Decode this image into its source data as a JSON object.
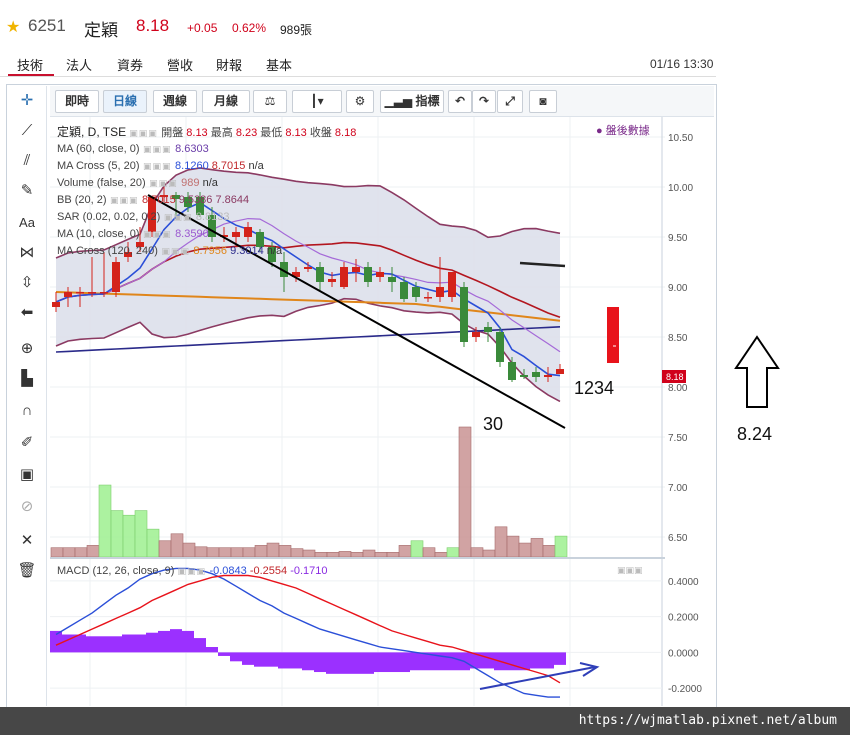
{
  "header": {
    "code": "6251",
    "name": "定穎",
    "price": "8.18",
    "change": "+0.05",
    "change_pct": "0.62%",
    "volume": "989張"
  },
  "tabs": [
    "技術",
    "法人",
    "資券",
    "營收",
    "財報",
    "基本"
  ],
  "datetime": "01/16 13:30",
  "toolbar": {
    "buttons": [
      "即時",
      "日線",
      "週線",
      "月線"
    ],
    "indicator_label": "指標"
  },
  "legend": {
    "title": "定穎, D, TSE",
    "ohlc": {
      "open_label": "開盤",
      "open": "8.13",
      "high_label": "最高",
      "high": "8.23",
      "low_label": "最低",
      "low": "8.13",
      "close_label": "收盤",
      "close": "8.18"
    },
    "after_hours": "盤後數據",
    "lines": [
      {
        "label": "MA (60, close, 0)",
        "values": [
          "8.6303"
        ],
        "colors": [
          "#6a3da8"
        ]
      },
      {
        "label": "MA Cross (5, 20)",
        "values": [
          "8.1260",
          "8.7015",
          "n/a"
        ],
        "colors": [
          "#2b4fd8",
          "#c0262a",
          "#333333"
        ]
      },
      {
        "label": "Volume (false, 20)",
        "values": [
          "989",
          "n/a"
        ],
        "colors": [
          "#c07070",
          "#333333"
        ]
      },
      {
        "label": "BB (20, 2)",
        "values": [
          "8.7015",
          "9.5386",
          "7.8644"
        ],
        "colors": [
          "#c0262a",
          "#8b3a62",
          "#8b3a62"
        ]
      },
      {
        "label": "SAR (0.02, 0.02, 0.2)",
        "values": [
          "8.8133"
        ],
        "colors": [
          "#bbbbbb"
        ]
      },
      {
        "label": "MA (10, close, 0)",
        "values": [
          "8.3590"
        ],
        "colors": [
          "#9b59d0"
        ]
      },
      {
        "label": "MA Cross (120, 240)",
        "values": [
          "8.7956",
          "9.3014",
          "n/a"
        ],
        "colors": [
          "#e0861a",
          "#2a2a8a",
          "#333333"
        ]
      }
    ],
    "macd_label": "MACD (12, 26, close, 9)",
    "macd_values": [
      "-0.0843",
      "-0.2554",
      "-0.1710"
    ],
    "macd_colors": [
      "#2b4fd8",
      "#c0262a",
      "#8a2be2"
    ]
  },
  "price_axis": [
    "10.50",
    "10.00",
    "9.50",
    "9.00",
    "8.50",
    "8.00",
    "7.50",
    "7.00",
    "6.50"
  ],
  "price_tag": "8.18",
  "macd_axis": [
    "0.4000",
    "0.2000",
    "0.0000",
    "-0.2000"
  ],
  "annotations": {
    "label_1234": "1234",
    "label_30": "30",
    "label_824": "8.24"
  },
  "watermark_url": "https://wjmatlab.pixnet.net/album",
  "chart_data": {
    "type": "candlestick",
    "price_range": [
      6.3,
      10.7
    ],
    "candles": [
      {
        "o": 8.8,
        "h": 8.95,
        "l": 8.75,
        "c": 8.85
      },
      {
        "o": 8.9,
        "h": 9.0,
        "l": 8.8,
        "c": 8.95
      },
      {
        "o": 8.95,
        "h": 9.0,
        "l": 8.8,
        "c": 8.95
      },
      {
        "o": 8.95,
        "h": 9.3,
        "l": 8.9,
        "c": 8.95
      },
      {
        "o": 8.95,
        "h": 9.35,
        "l": 8.9,
        "c": 8.95
      },
      {
        "o": 8.95,
        "h": 9.3,
        "l": 8.9,
        "c": 9.25
      },
      {
        "o": 9.3,
        "h": 9.45,
        "l": 9.25,
        "c": 9.35
      },
      {
        "o": 9.4,
        "h": 9.6,
        "l": 9.35,
        "c": 9.45
      },
      {
        "o": 9.55,
        "h": 9.9,
        "l": 9.5,
        "c": 9.9
      },
      {
        "o": 9.9,
        "h": 10.0,
        "l": 9.85,
        "c": 9.92
      },
      {
        "o": 9.92,
        "h": 9.95,
        "l": 9.7,
        "c": 9.88
      },
      {
        "o": 9.9,
        "h": 9.95,
        "l": 9.75,
        "c": 9.8
      },
      {
        "o": 9.9,
        "h": 9.95,
        "l": 9.7,
        "c": 9.72
      },
      {
        "o": 9.72,
        "h": 9.8,
        "l": 9.45,
        "c": 9.5
      },
      {
        "o": 9.5,
        "h": 9.6,
        "l": 9.45,
        "c": 9.52
      },
      {
        "o": 9.5,
        "h": 9.6,
        "l": 9.4,
        "c": 9.55
      },
      {
        "o": 9.5,
        "h": 9.65,
        "l": 9.45,
        "c": 9.6
      },
      {
        "o": 9.55,
        "h": 9.58,
        "l": 9.35,
        "c": 9.4
      },
      {
        "o": 9.4,
        "h": 9.45,
        "l": 9.2,
        "c": 9.25
      },
      {
        "o": 9.25,
        "h": 9.35,
        "l": 8.95,
        "c": 9.1
      },
      {
        "o": 9.1,
        "h": 9.2,
        "l": 9.05,
        "c": 9.15
      },
      {
        "o": 9.18,
        "h": 9.25,
        "l": 9.15,
        "c": 9.2
      },
      {
        "o": 9.2,
        "h": 9.25,
        "l": 8.95,
        "c": 9.05
      },
      {
        "o": 9.05,
        "h": 9.15,
        "l": 9.0,
        "c": 9.08
      },
      {
        "o": 9.0,
        "h": 9.25,
        "l": 8.98,
        "c": 9.2
      },
      {
        "o": 9.15,
        "h": 9.28,
        "l": 9.05,
        "c": 9.2
      },
      {
        "o": 9.2,
        "h": 9.25,
        "l": 9.0,
        "c": 9.05
      },
      {
        "o": 9.1,
        "h": 9.2,
        "l": 9.05,
        "c": 9.15
      },
      {
        "o": 9.1,
        "h": 9.2,
        "l": 8.95,
        "c": 9.05
      },
      {
        "o": 9.05,
        "h": 9.1,
        "l": 8.85,
        "c": 8.88
      },
      {
        "o": 9.0,
        "h": 9.05,
        "l": 8.85,
        "c": 8.9
      },
      {
        "o": 8.9,
        "h": 8.95,
        "l": 8.85,
        "c": 8.9
      },
      {
        "o": 8.9,
        "h": 9.3,
        "l": 8.85,
        "c": 9.0
      },
      {
        "o": 8.9,
        "h": 9.15,
        "l": 8.85,
        "c": 9.15
      },
      {
        "o": 9.0,
        "h": 9.05,
        "l": 8.4,
        "c": 8.45
      },
      {
        "o": 8.5,
        "h": 8.6,
        "l": 8.45,
        "c": 8.55
      },
      {
        "o": 8.6,
        "h": 8.65,
        "l": 8.45,
        "c": 8.55
      },
      {
        "o": 8.55,
        "h": 8.6,
        "l": 8.2,
        "c": 8.25
      },
      {
        "o": 8.25,
        "h": 8.3,
        "l": 8.05,
        "c": 8.07
      },
      {
        "o": 8.12,
        "h": 8.18,
        "l": 8.08,
        "c": 8.1
      },
      {
        "o": 8.15,
        "h": 8.2,
        "l": 8.05,
        "c": 8.1
      },
      {
        "o": 8.1,
        "h": 8.2,
        "l": 8.05,
        "c": 8.12
      },
      {
        "o": 8.13,
        "h": 8.23,
        "l": 8.13,
        "c": 8.18
      }
    ],
    "volume": [
      0.2,
      0.2,
      0.2,
      0.25,
      1.55,
      1.0,
      0.9,
      1.0,
      0.6,
      0.35,
      0.5,
      0.3,
      0.22,
      0.2,
      0.2,
      0.2,
      0.2,
      0.25,
      0.3,
      0.25,
      0.18,
      0.15,
      0.1,
      0.1,
      0.12,
      0.1,
      0.15,
      0.1,
      0.1,
      0.25,
      0.35,
      0.2,
      0.1,
      0.2,
      2.8,
      0.2,
      0.15,
      0.65,
      0.45,
      0.3,
      0.4,
      0.25,
      0.45
    ],
    "volume_up": [
      false,
      false,
      false,
      false,
      true,
      true,
      true,
      true,
      true,
      false,
      false,
      false,
      false,
      false,
      false,
      false,
      false,
      false,
      false,
      false,
      false,
      false,
      false,
      false,
      false,
      false,
      false,
      false,
      false,
      false,
      true,
      false,
      false,
      true,
      false,
      false,
      false,
      false,
      false,
      false,
      false,
      false,
      true
    ],
    "macd_range": [
      -0.3,
      0.5
    ],
    "macd_hist": [
      0.12,
      0.1,
      0.1,
      0.09,
      0.09,
      0.09,
      0.1,
      0.1,
      0.11,
      0.12,
      0.13,
      0.12,
      0.08,
      0.03,
      -0.02,
      -0.05,
      -0.07,
      -0.08,
      -0.08,
      -0.09,
      -0.09,
      -0.1,
      -0.11,
      -0.12,
      -0.12,
      -0.12,
      -0.12,
      -0.11,
      -0.11,
      -0.11,
      -0.1,
      -0.1,
      -0.1,
      -0.1,
      -0.1,
      -0.09,
      -0.09,
      -0.1,
      -0.1,
      -0.1,
      -0.09,
      -0.09,
      -0.07
    ],
    "macd_line": [
      0.1,
      0.14,
      0.18,
      0.22,
      0.27,
      0.32,
      0.36,
      0.41,
      0.44,
      0.46,
      0.47,
      0.47,
      0.46,
      0.44,
      0.41,
      0.37,
      0.33,
      0.29,
      0.26,
      0.22,
      0.19,
      0.16,
      0.13,
      0.11,
      0.09,
      0.07,
      0.05,
      0.03,
      0.02,
      0.01,
      0.0,
      -0.01,
      -0.02,
      -0.03,
      -0.05,
      -0.09,
      -0.13,
      -0.17,
      -0.2,
      -0.23,
      -0.24,
      -0.25,
      -0.25
    ],
    "signal_line": [
      0.04,
      0.07,
      0.1,
      0.13,
      0.16,
      0.19,
      0.22,
      0.25,
      0.29,
      0.32,
      0.35,
      0.38,
      0.4,
      0.42,
      0.43,
      0.43,
      0.43,
      0.42,
      0.4,
      0.38,
      0.36,
      0.33,
      0.3,
      0.27,
      0.24,
      0.21,
      0.18,
      0.15,
      0.12,
      0.1,
      0.08,
      0.06,
      0.04,
      0.03,
      0.01,
      -0.01,
      -0.03,
      -0.05,
      -0.07,
      -0.09,
      -0.11,
      -0.13,
      -0.17
    ]
  }
}
